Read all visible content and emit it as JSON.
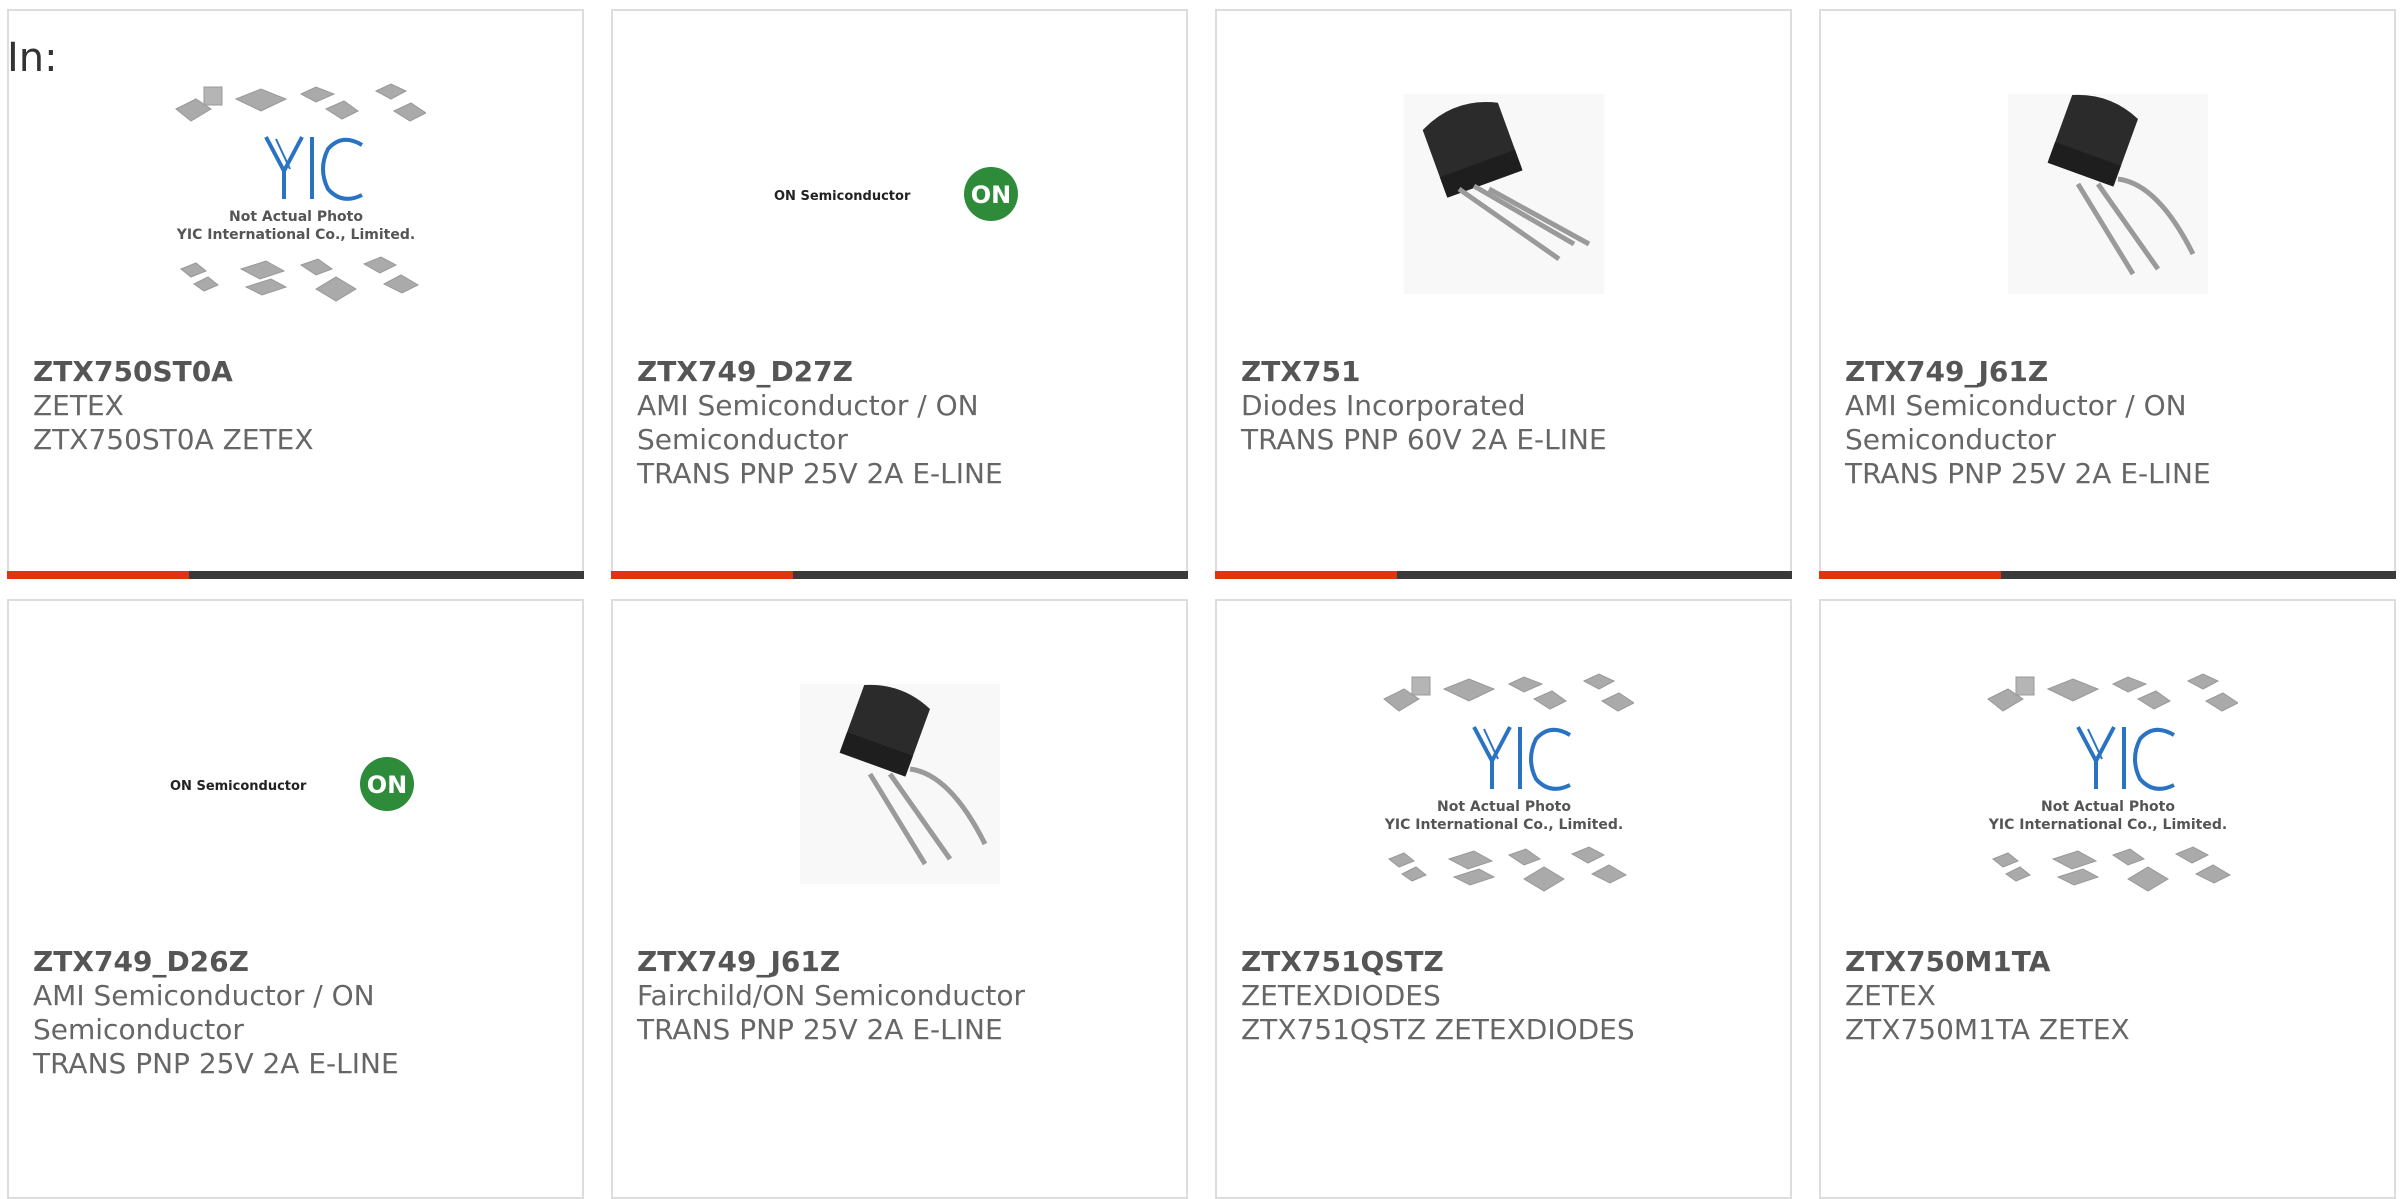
{
  "page": {
    "label": "In:"
  },
  "colors": {
    "accent": "#e2330f",
    "bar": "#3a3a3a",
    "border": "#dddddd",
    "text": "#666666",
    "on_logo_green": "#2e8b3a",
    "yic_blue": "#2a73c2"
  },
  "products": [
    {
      "part": "ZTX750ST0A",
      "manufacturer": "ZETEX",
      "description": "ZTX750ST0A ZETEX",
      "image": "yic-placeholder",
      "placeholder_line1": "Not Actual Photo",
      "placeholder_line2": "YIC International Co., Limited."
    },
    {
      "part": "ZTX749_D27Z",
      "manufacturer": "AMI Semiconductor / ON Semiconductor",
      "description": "TRANS PNP 25V 2A E-LINE",
      "image": "on-semi-logo",
      "logo_text": "ON Semiconductor",
      "logo_badge": "ON"
    },
    {
      "part": "ZTX751",
      "manufacturer": "Diodes Incorporated",
      "description": "TRANS PNP 60V 2A E-LINE",
      "image": "transistor-photo"
    },
    {
      "part": "ZTX749_J61Z",
      "manufacturer": "AMI Semiconductor / ON Semiconductor",
      "description": "TRANS PNP 25V 2A E-LINE",
      "image": "transistor-photo"
    },
    {
      "part": "ZTX749_D26Z",
      "manufacturer": "AMI Semiconductor / ON Semiconductor",
      "description": "TRANS PNP 25V 2A E-LINE",
      "image": "on-semi-logo",
      "logo_text": "ON Semiconductor",
      "logo_badge": "ON"
    },
    {
      "part": "ZTX749_J61Z",
      "manufacturer": "Fairchild/ON Semiconductor",
      "description": "TRANS PNP 25V 2A E-LINE",
      "image": "transistor-photo"
    },
    {
      "part": "ZTX751QSTZ",
      "manufacturer": "ZETEXDIODES",
      "description": "ZTX751QSTZ ZETEXDIODES",
      "image": "yic-placeholder",
      "placeholder_line1": "Not Actual Photo",
      "placeholder_line2": "YIC International Co., Limited."
    },
    {
      "part": "ZTX750M1TA",
      "manufacturer": "ZETEX",
      "description": "ZTX750M1TA ZETEX",
      "image": "yic-placeholder",
      "placeholder_line1": "Not Actual Photo",
      "placeholder_line2": "YIC International Co., Limited."
    }
  ]
}
